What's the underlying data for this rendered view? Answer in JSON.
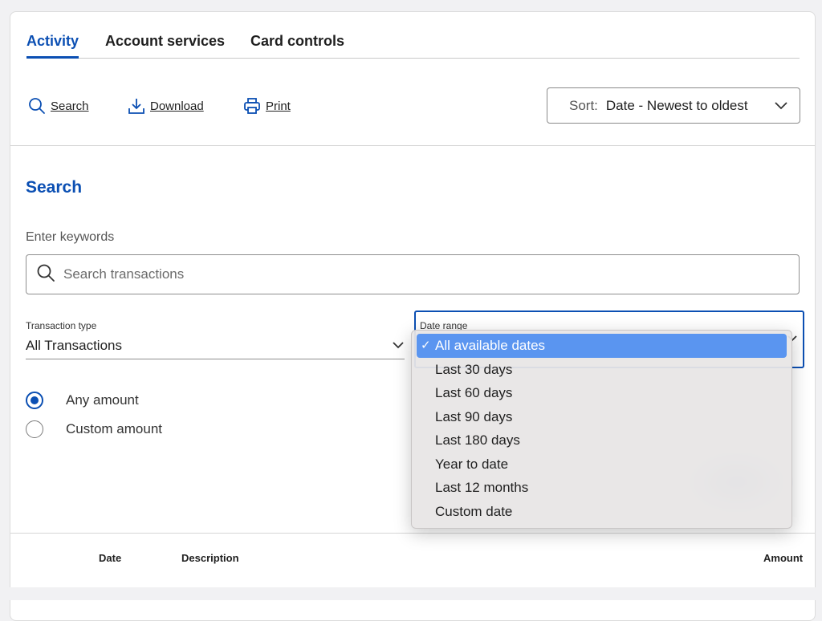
{
  "tabs": [
    {
      "label": "Activity",
      "active": true
    },
    {
      "label": "Account services",
      "active": false
    },
    {
      "label": "Card controls",
      "active": false
    }
  ],
  "toolbar": {
    "search_label": "Search",
    "download_label": "Download",
    "print_label": "Print",
    "sort_label": "Sort:",
    "sort_value": "Date - Newest to oldest"
  },
  "search_panel": {
    "title": "Search",
    "keywords_label": "Enter keywords",
    "search_placeholder": "Search transactions",
    "transaction_type_label": "Transaction type",
    "transaction_type_value": "All Transactions",
    "date_range_label": "Date range",
    "amount_options": [
      {
        "label": "Any amount",
        "selected": true
      },
      {
        "label": "Custom amount",
        "selected": false
      }
    ]
  },
  "date_range_menu": {
    "selected_index": 0,
    "check_mark": "✓",
    "options": [
      "All available dates",
      "Last 30 days",
      "Last 60 days",
      "Last 90 days",
      "Last 180 days",
      "Year to date",
      "Last 12 months",
      "Custom date"
    ]
  },
  "table_headers": {
    "date": "Date",
    "description": "Description",
    "amount": "Amount"
  },
  "colors": {
    "accent": "#0b4fb3",
    "menu_highlight": "#5a95f0",
    "page_background": "#f1f1f3"
  }
}
